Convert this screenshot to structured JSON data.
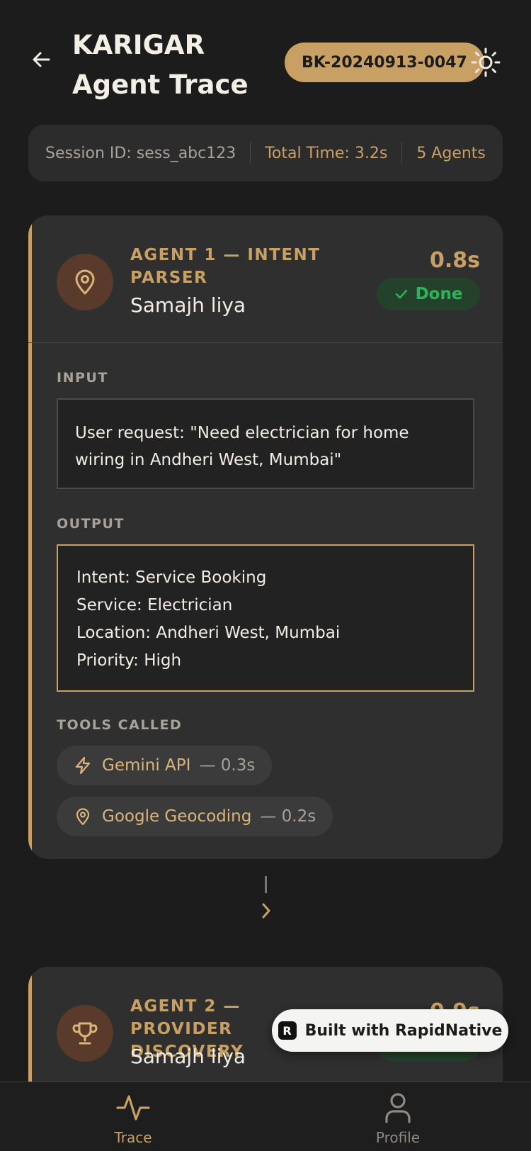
{
  "header": {
    "title": "KARIGAR Agent Trace",
    "booking_id": "BK-20240913-0047"
  },
  "summary": {
    "session": "Session ID: sess_abc123",
    "total_time": "Total Time: 3.2s",
    "agents": "5 Agents"
  },
  "agents": [
    {
      "tag": "AGENT 1 — INTENT PARSER",
      "name": "Samajh liya",
      "time": "0.8s",
      "status": "Done",
      "icon": "map-pin-icon",
      "input_label": "INPUT",
      "input": "User request: \"Need electrician for home wiring in Andheri West, Mumbai\"",
      "output_label": "OUTPUT",
      "output": [
        "Intent: Service Booking",
        "Service: Electrician",
        "Location: Andheri West, Mumbai",
        "Priority: High"
      ],
      "tools_label": "TOOLS CALLED",
      "tools": [
        {
          "name": "Gemini API",
          "duration": "— 0.3s",
          "icon": "lightning-icon"
        },
        {
          "name": "Google Geocoding",
          "duration": "— 0.2s",
          "icon": "map-pin-icon"
        }
      ]
    },
    {
      "tag": "AGENT 2 — PROVIDER DISCOVERY",
      "name": "Samajh liya",
      "time": "0.9s",
      "icon": "trophy-icon"
    }
  ],
  "built_with": "Built with RapidNative",
  "nav": {
    "trace": "Trace",
    "profile": "Profile"
  },
  "colors": {
    "background": "#1c1c1c",
    "card": "#2f2f2f",
    "accent": "#c9a063",
    "success": "#2fb35a"
  }
}
